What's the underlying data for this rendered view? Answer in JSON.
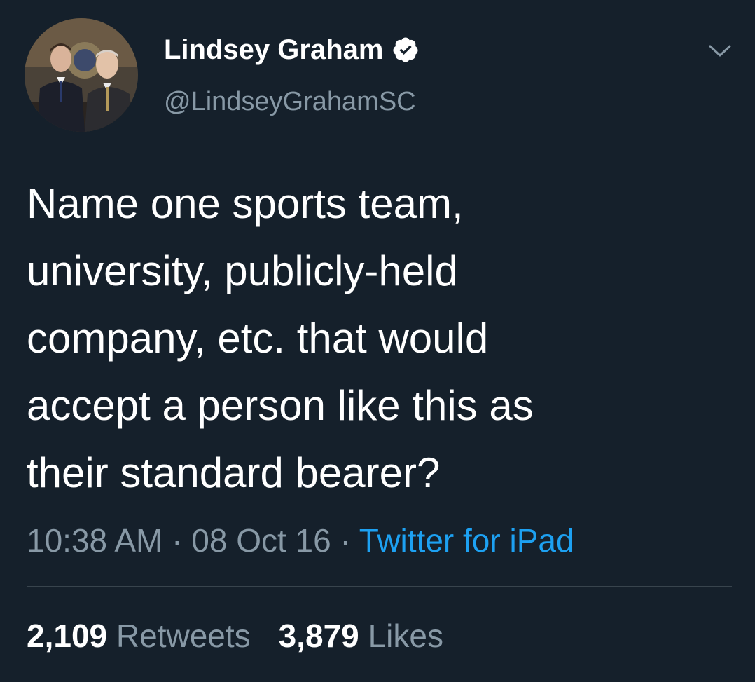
{
  "author": {
    "display_name": "Lindsey Graham",
    "handle": "@LindseyGrahamSC",
    "verified": true,
    "avatar_icon": "profile-photo"
  },
  "tweet": {
    "text": "Name one sports team,\nuniversity, publicly-held\ncompany, etc. that would\naccept a person like this as\ntheir standard bearer?",
    "time": "10:38 AM",
    "separator": "·",
    "date": "08 Oct 16",
    "source": "Twitter for iPad"
  },
  "stats": {
    "retweets_count": "2,109",
    "retweets_label": "Retweets",
    "likes_count": "3,879",
    "likes_label": "Likes"
  },
  "icons": {
    "verified": "verified-badge-icon",
    "menu": "chevron-down-icon"
  },
  "colors": {
    "background": "#15202b",
    "primary_text": "#ffffff",
    "secondary_text": "#8899a6",
    "link": "#1da1f2",
    "divider": "#38444d"
  }
}
